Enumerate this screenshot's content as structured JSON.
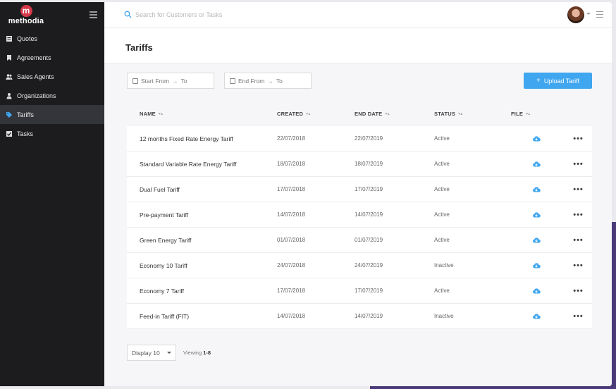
{
  "app": {
    "logo_letter": "m",
    "logo_text": "methodia"
  },
  "sidebar": {
    "items": [
      {
        "label": "Quotes",
        "icon": "quote-icon"
      },
      {
        "label": "Agreements",
        "icon": "bookmark-icon"
      },
      {
        "label": "Sales Agents",
        "icon": "users-icon"
      },
      {
        "label": "Organizations",
        "icon": "user-icon"
      },
      {
        "label": "Tariffs",
        "icon": "tag-icon",
        "active": true
      },
      {
        "label": "Tasks",
        "icon": "checkbox-icon"
      }
    ]
  },
  "topbar": {
    "search_placeholder": "Search for Customers or Tasks"
  },
  "page": {
    "title": "Tariffs"
  },
  "filters": {
    "start": {
      "from": "Start From",
      "to": "To"
    },
    "end": {
      "from": "End From",
      "to": "To"
    }
  },
  "upload": {
    "plus": "+",
    "label": "Upload Tariff"
  },
  "table": {
    "columns": [
      "NAME",
      "CREATED",
      "END DATE",
      "STATUS",
      "FILE"
    ],
    "sort_glyph": "▾▴",
    "more_glyph": "•••",
    "rows": [
      {
        "name": "12 months Fixed Rate Energy Tariff",
        "created": "22/07/2018",
        "end": "22/07/2019",
        "status": "Active"
      },
      {
        "name": "Standard Variable Rate Energy Tariff",
        "created": "18/07/2018",
        "end": "18/07/2019",
        "status": "Active"
      },
      {
        "name": "Dual Fuel Tariff",
        "created": "17/07/2018",
        "end": "17/07/2019",
        "status": "Active"
      },
      {
        "name": "Pre-payment Tariff",
        "created": "14/07/2018",
        "end": "14/07/2019",
        "status": "Active"
      },
      {
        "name": "Green Energy Tariff",
        "created": "01/07/2018",
        "end": "01/07/2019",
        "status": "Active"
      },
      {
        "name": "Economy 10 Tariff",
        "created": "24/07/2018",
        "end": "24/07/2019",
        "status": "Inactive"
      },
      {
        "name": "Economy 7 Tariff",
        "created": "17/07/2018",
        "end": "17/07/2019",
        "status": "Active"
      },
      {
        "name": "Feed-in Tariff (FIT)",
        "created": "14/07/2018",
        "end": "14/07/2019",
        "status": "Inactive"
      }
    ]
  },
  "footer": {
    "display_label": "Display 10",
    "viewing_prefix": "Viewing",
    "viewing_range": "1-8"
  },
  "colors": {
    "accent": "#3fa6ef",
    "sidebar_bg": "#1c1c1e",
    "logo": "#d6384a"
  }
}
